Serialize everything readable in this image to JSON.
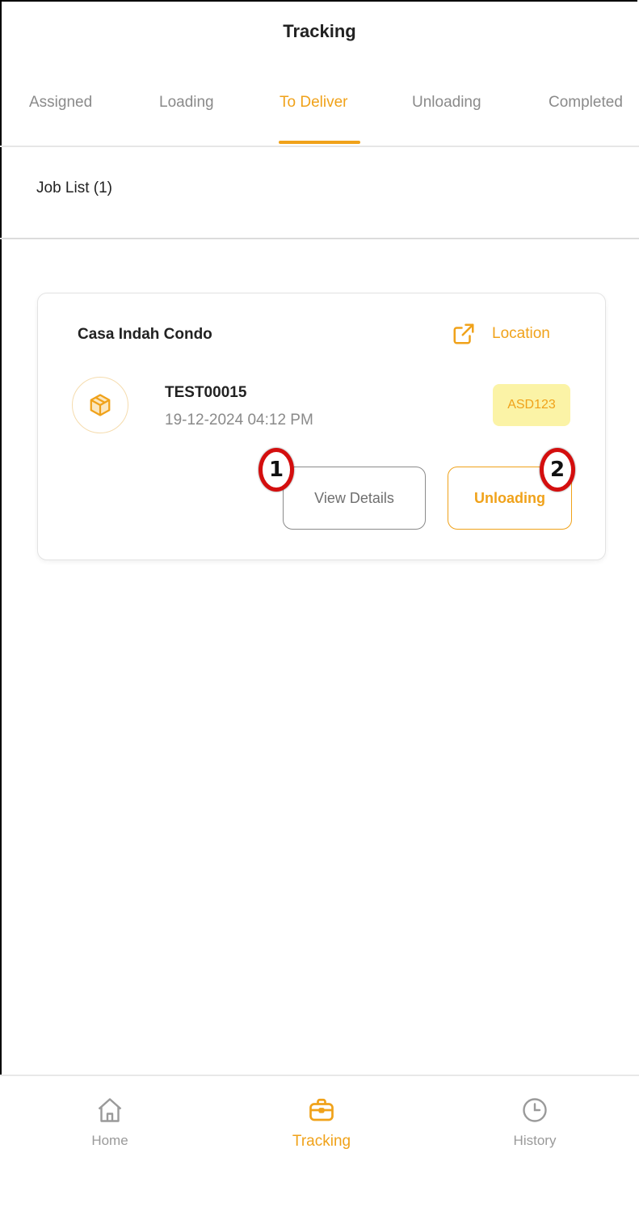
{
  "header": {
    "title": "Tracking"
  },
  "tabs": [
    {
      "label": "Assigned",
      "active": false
    },
    {
      "label": "Loading",
      "active": false
    },
    {
      "label": "To Deliver",
      "active": true
    },
    {
      "label": "Unloading",
      "active": false
    },
    {
      "label": "Completed",
      "active": false
    }
  ],
  "job_list": {
    "label": "Job List (1)"
  },
  "job": {
    "site_name": "Casa Indah Condo",
    "location_label": "Location",
    "job_id": "TEST00015",
    "datetime": "19-12-2024 04:12 PM",
    "plate": "ASD123",
    "view_details_label": "View Details",
    "unloading_label": "Unloading",
    "icons": {
      "location": "external-link-icon",
      "package": "package-icon"
    }
  },
  "annotations": {
    "marker_1": "1",
    "marker_2": "2"
  },
  "bottom_nav": [
    {
      "label": "Home",
      "icon": "home-icon",
      "active": false
    },
    {
      "label": "Tracking",
      "icon": "briefcase-icon",
      "active": true
    },
    {
      "label": "History",
      "icon": "clock-icon",
      "active": false
    }
  ],
  "colors": {
    "accent": "#f0a21a",
    "badge_bg": "#fbf3a6",
    "marker_ring": "#d40e0e"
  }
}
